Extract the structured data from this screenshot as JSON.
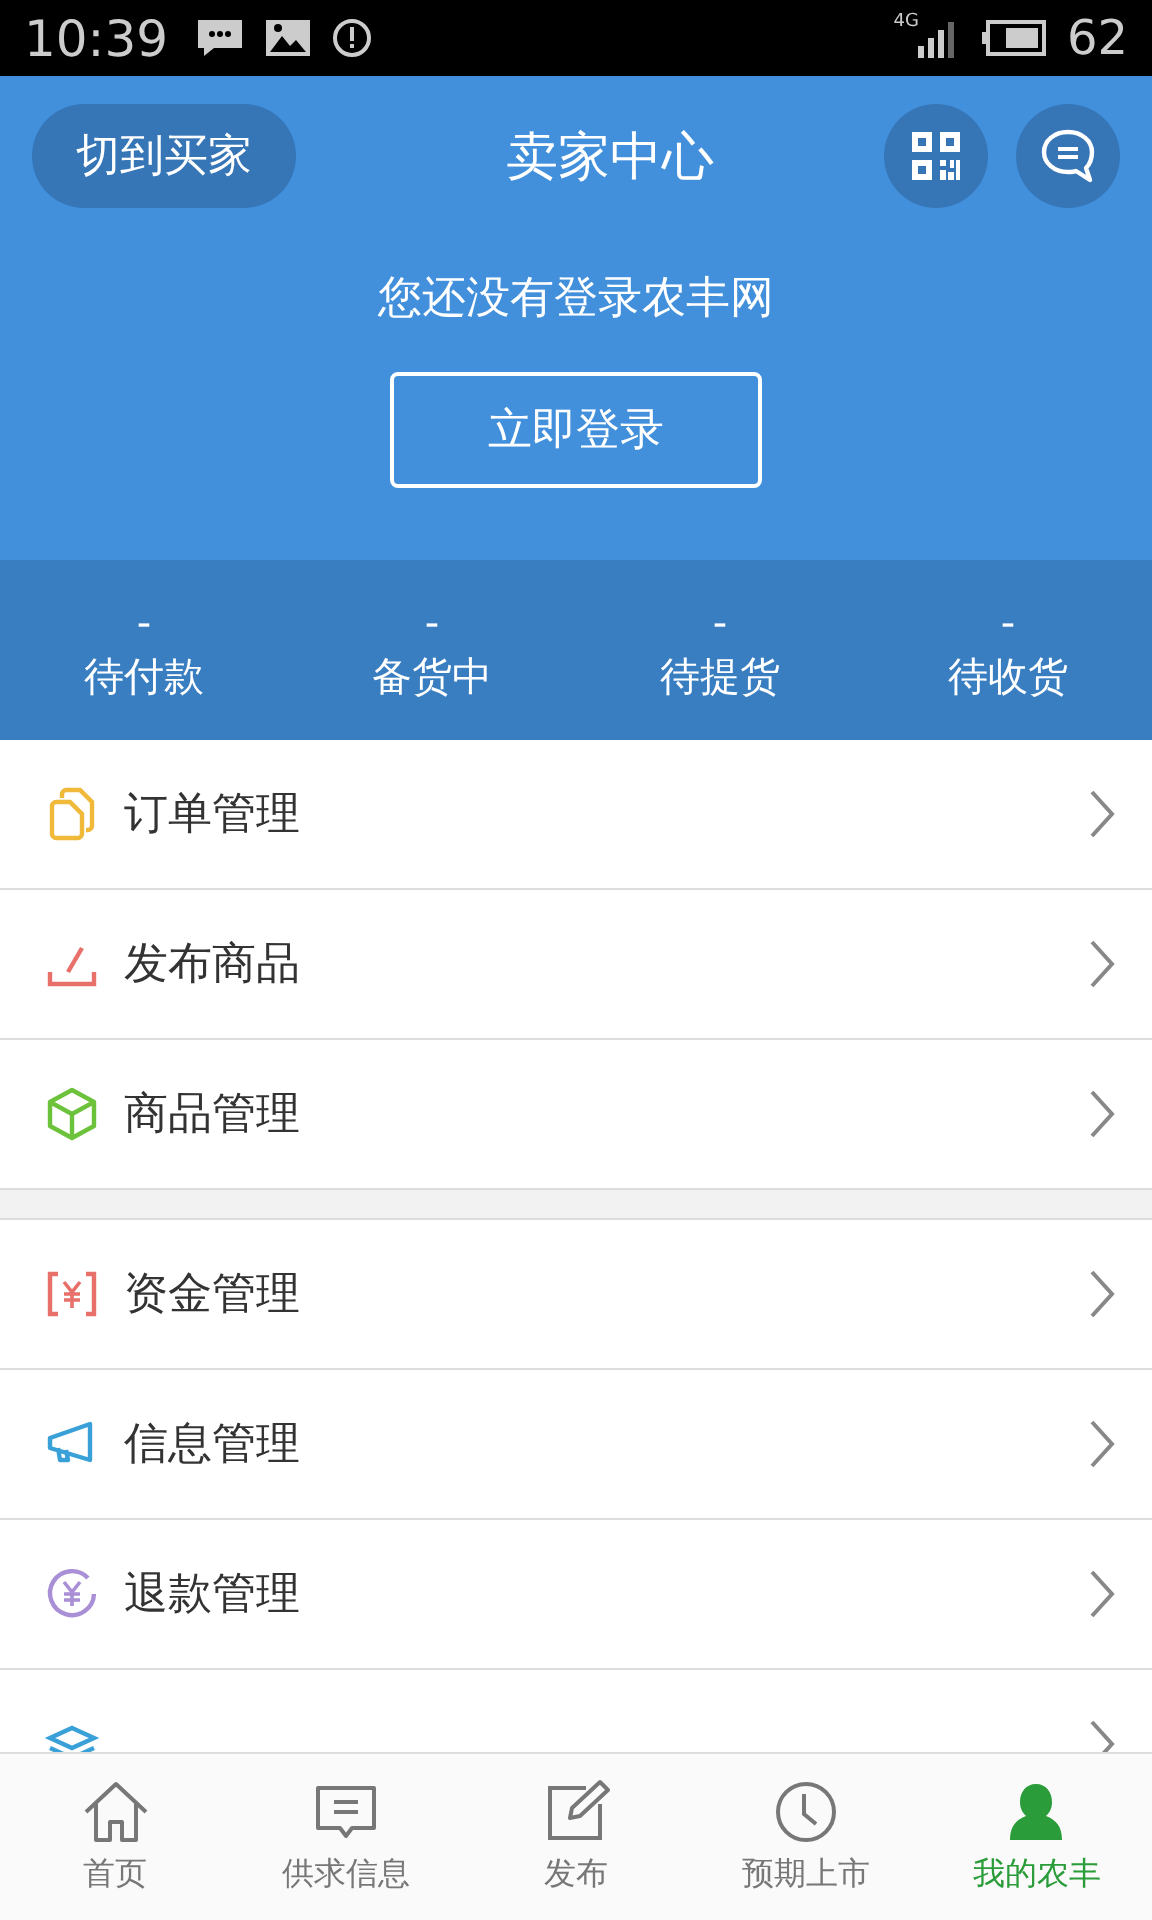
{
  "status_bar": {
    "time": "10:39",
    "battery_text": "62",
    "network": "4G"
  },
  "header": {
    "switch_button": "切到买家",
    "title": "卖家中心",
    "login_prompt": "您还没有登录农丰网",
    "login_button": "立即登录"
  },
  "stats": [
    {
      "value": "-",
      "label": "待付款"
    },
    {
      "value": "-",
      "label": "备货中"
    },
    {
      "value": "-",
      "label": "待提货"
    },
    {
      "value": "-",
      "label": "待收货"
    }
  ],
  "menu_groups": [
    [
      {
        "kind": "orders",
        "label": "订单管理"
      },
      {
        "kind": "publish",
        "label": "发布商品"
      },
      {
        "kind": "goods",
        "label": "商品管理"
      }
    ],
    [
      {
        "kind": "funds",
        "label": "资金管理"
      },
      {
        "kind": "info",
        "label": "信息管理"
      },
      {
        "kind": "refund",
        "label": "退款管理"
      },
      {
        "kind": "marketing"
      }
    ]
  ],
  "tab_bar": [
    {
      "kind": "home",
      "label": "首页",
      "selected": false
    },
    {
      "kind": "supply",
      "label": "供求信息",
      "selected": false
    },
    {
      "kind": "publish",
      "label": "发布",
      "selected": false
    },
    {
      "kind": "clock",
      "label": "预期上市",
      "selected": false
    },
    {
      "kind": "user",
      "label": "我的农丰",
      "selected": true
    }
  ]
}
